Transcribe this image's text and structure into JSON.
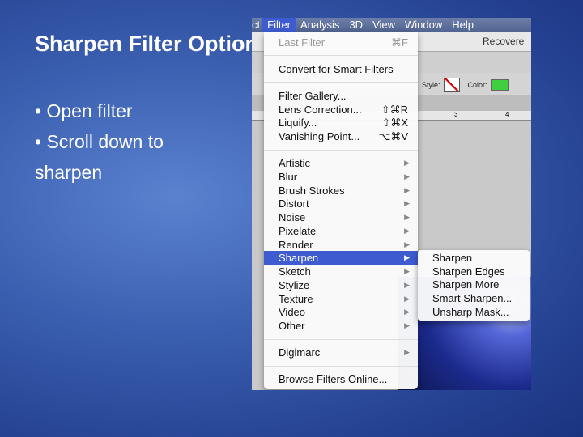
{
  "slide": {
    "title": "Sharpen Filter Options",
    "bullets": [
      "• Open filter",
      "• Scroll down to\nsharpen"
    ]
  },
  "menubar": {
    "items": [
      "ct",
      "Filter",
      "Analysis",
      "3D",
      "View",
      "Window",
      "Help"
    ]
  },
  "toolbar": {
    "document": "Recovere",
    "style_label": "Style:",
    "color_label": "Color:",
    "color": "#3fcf3f",
    "ruler": [
      "3",
      "4"
    ]
  },
  "filter_menu": {
    "last_filter": {
      "label": "Last Filter",
      "shortcut": "⌘F"
    },
    "convert": "Convert for Smart Filters",
    "group1": [
      {
        "label": "Filter Gallery...",
        "shortcut": ""
      },
      {
        "label": "Lens Correction...",
        "shortcut": "⇧⌘R"
      },
      {
        "label": "Liquify...",
        "shortcut": "⇧⌘X"
      },
      {
        "label": "Vanishing Point...",
        "shortcut": "⌥⌘V"
      }
    ],
    "group2": [
      "Artistic",
      "Blur",
      "Brush Strokes",
      "Distort",
      "Noise",
      "Pixelate",
      "Render",
      "Sharpen",
      "Sketch",
      "Stylize",
      "Texture",
      "Video",
      "Other"
    ],
    "digimarc": "Digimarc",
    "browse": "Browse Filters Online...",
    "highlighted": "Sharpen"
  },
  "sharpen_submenu": [
    "Sharpen",
    "Sharpen Edges",
    "Sharpen More",
    "Smart Sharpen...",
    "Unsharp Mask..."
  ]
}
